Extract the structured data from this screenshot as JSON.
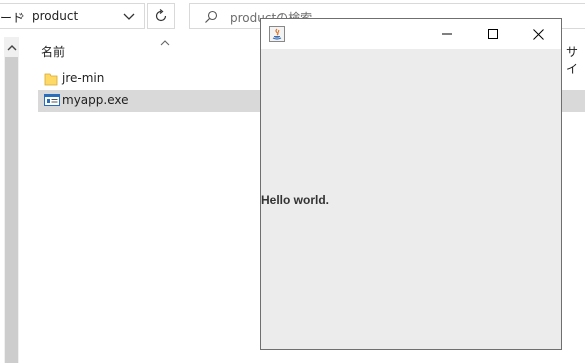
{
  "explorer": {
    "address": {
      "previous_segment": "ード",
      "separator": "›",
      "current_segment": "product"
    },
    "search": {
      "placeholder": "productの検索"
    },
    "columns": {
      "name": "名前",
      "size": "サイ"
    },
    "files": [
      {
        "name": "jre-min",
        "icon": "folder-icon",
        "selected": false
      },
      {
        "name": "myapp.exe",
        "icon": "exe-icon",
        "selected": true
      }
    ]
  },
  "java_window": {
    "label": "Hello world.",
    "icon": "java-icon"
  },
  "colors": {
    "explorer_bg": "#ffffff",
    "selected_row": "#d9d9d9",
    "java_content_bg": "#ececec",
    "folder_yellow": "#ffd966"
  }
}
